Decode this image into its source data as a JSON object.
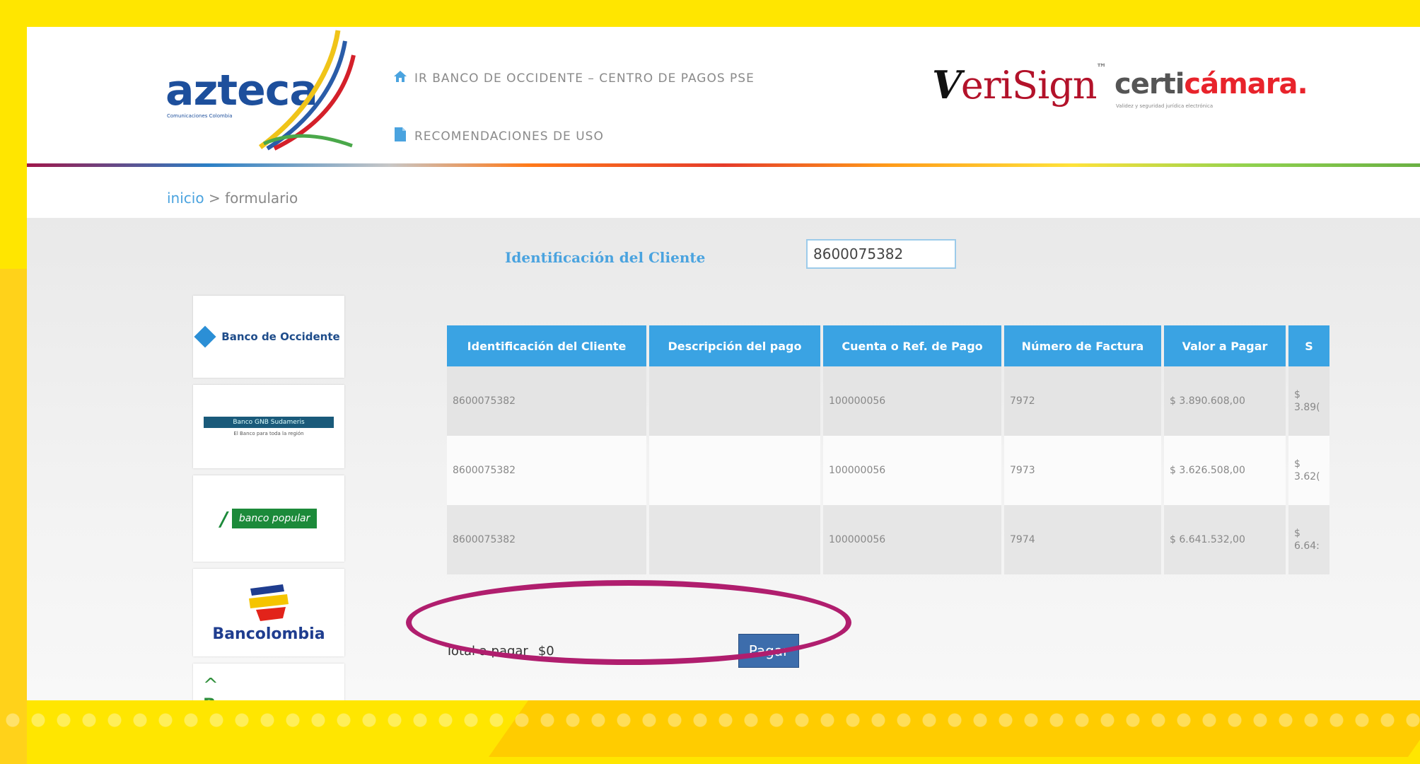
{
  "header": {
    "logo_text": "azteca",
    "logo_sub": "Comunicaciones Colombia",
    "nav": [
      {
        "label": "IR BANCO DE OCCIDENTE – CENTRO DE PAGOS PSE",
        "icon": "home-icon"
      },
      {
        "label": "RECOMENDACIONES DE USO",
        "icon": "document-icon"
      }
    ],
    "verisign": {
      "v": "V",
      "rest": "eriSign"
    },
    "certicamara": {
      "prefix": "certi",
      "brand": "cámara.",
      "sub": "Validez y seguridad jurídica electrónica"
    }
  },
  "breadcrumb": {
    "home": "inicio",
    "sep": ">",
    "current": "formulario"
  },
  "form": {
    "label": "Identificación del Cliente",
    "value": "8600075382"
  },
  "banks": [
    {
      "name": "Banco de Occidente"
    },
    {
      "name": "Banco GNB Sudameris",
      "tagline": "El Banco para toda la región"
    },
    {
      "name": "banco popular"
    },
    {
      "name": "Bancolombia"
    },
    {
      "name": "Bancoomeva"
    }
  ],
  "table": {
    "headers": [
      "Identificación del Cliente",
      "Descripción del pago",
      "Cuenta o Ref. de Pago",
      "Número de Factura",
      "Valor a Pagar",
      "S"
    ],
    "rows": [
      {
        "id": "8600075382",
        "desc": "",
        "ref": "100000056",
        "factura": "7972",
        "valor": "$ 3.890.608,00",
        "s1": "$",
        "s2": "3.89("
      },
      {
        "id": "8600075382",
        "desc": "",
        "ref": "100000056",
        "factura": "7973",
        "valor": "$ 3.626.508,00",
        "s1": "$",
        "s2": "3.62("
      },
      {
        "id": "8600075382",
        "desc": "",
        "ref": "100000056",
        "factura": "7974",
        "valor": "$ 6.641.532,00",
        "s1": "$",
        "s2": "6.64:"
      }
    ]
  },
  "total": {
    "label": "Total a pagar",
    "amount": "$0"
  },
  "pay_button": "Pagar",
  "colors": {
    "frame": "#ffe600",
    "accent": "#3aa3e3",
    "button": "#3d6dac",
    "highlight": "#b01e6e"
  }
}
